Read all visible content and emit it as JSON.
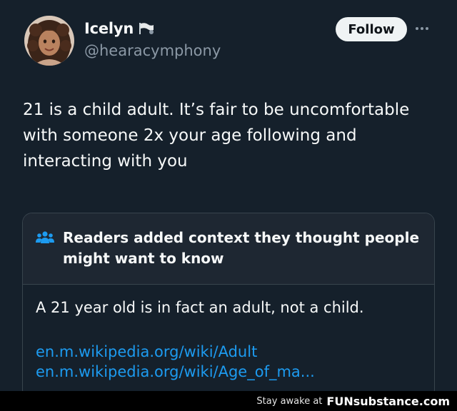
{
  "author": {
    "name": "Icelyn",
    "handle": "@hearacymphony",
    "follow_label": "Follow"
  },
  "tweet": {
    "text": "21 is a child adult. It’s fair to be uncomfortable with someone 2x your age following and interacting with you"
  },
  "community_note": {
    "header": "Readers added context they thought people might want to know",
    "body": "A 21 year old is in fact an adult, not a child.",
    "links": [
      "en.m.wikipedia.org/wiki/Adult",
      "en.m.wikipedia.org/wiki/Age_of_ma..."
    ]
  },
  "watermark": {
    "text": "Stay awake at",
    "brand": "FUNsubstance.com"
  },
  "colors": {
    "background": "#15202b",
    "link": "#1d9bf0",
    "muted": "#8b98a5",
    "note_border": "#38444d"
  }
}
